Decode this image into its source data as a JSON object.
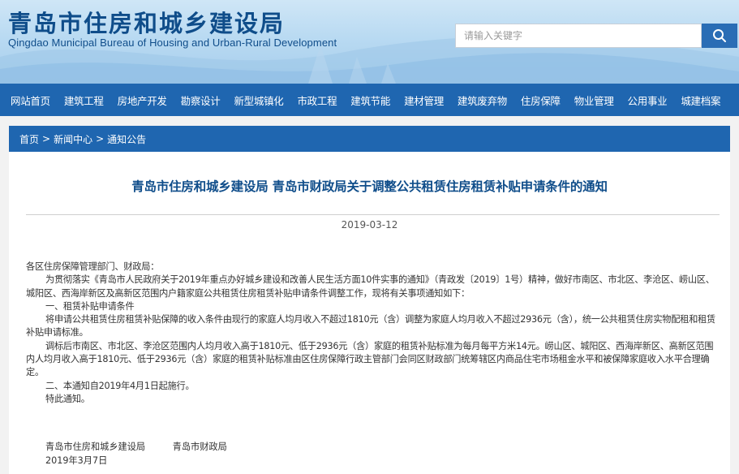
{
  "header": {
    "title": "青岛市住房和城乡建设局",
    "subtitle": "Qingdao Municipal Bureau of Housing and Urban-Rural Development",
    "search_placeholder": "请输入关键字",
    "search_icon": "search-icon",
    "colors": {
      "brand": "#0f4d8a",
      "accent": "#1f66b0"
    }
  },
  "nav": {
    "items": [
      "网站首页",
      "建筑工程",
      "房地产开发",
      "勘察设计",
      "新型城镇化",
      "市政工程",
      "建筑节能",
      "建材管理",
      "建筑废弃物",
      "住房保障",
      "物业管理",
      "公用事业",
      "城建档案"
    ]
  },
  "breadcrumb": {
    "items": [
      "首页",
      "新闻中心",
      "通知公告"
    ],
    "separator": ">"
  },
  "article": {
    "title": "青岛市住房和城乡建设局 青岛市财政局关于调整公共租赁住房租赁补贴申请条件的通知",
    "date": "2019-03-12",
    "paragraphs": [
      "各区住房保障管理部门、财政局：",
      "为贯彻落实《青岛市人民政府关于2019年重点办好城乡建设和改善人民生活方面10件实事的通知》（青政发〔2019〕1号）精神，做好市南区、市北区、李沧区、崂山区、城阳区、西海岸新区及高新区范围内户籍家庭公共租赁住房租赁补贴申请条件调整工作，现将有关事项通知如下：",
      "一、租赁补贴申请条件",
      "将申请公共租赁住房租赁补贴保障的收入条件由现行的家庭人均月收入不超过1810元（含）调整为家庭人均月收入不超过2936元（含），统一公共租赁住房实物配租和租赁补贴申请标准。",
      "调标后市南区、市北区、李沧区范围内人均月收入高于1810元、低于2936元（含）家庭的租赁补贴标准为每月每平方米14元。崂山区、城阳区、西海岸新区、高新区范围内人均月收入高于1810元、低于2936元（含）家庭的租赁补贴标准由区住房保障行政主管部门会同区财政部门统筹辖区内商品住宅市场租金水平和被保障家庭收入水平合理确定。",
      "二、本通知自2019年4月1日起施行。",
      "特此通知。"
    ],
    "signers": "青岛市住房和城乡建设局　　　青岛市财政局",
    "sign_date": "2019年3月7日"
  }
}
